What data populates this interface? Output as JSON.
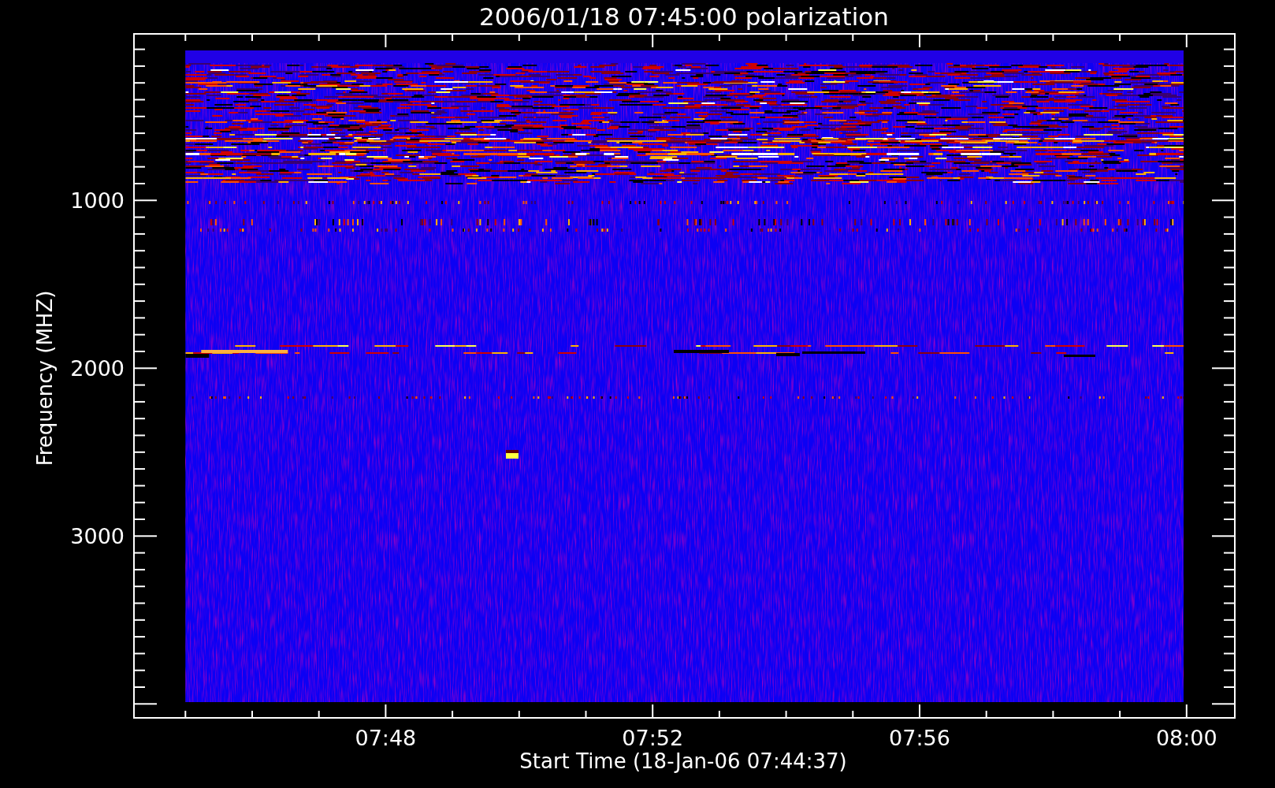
{
  "title": "2006/01/18 07:45:00 polarization",
  "xlabel": "Start Time (18-Jan-06 07:44:37)",
  "ylabel": "Frequency (MHZ)",
  "xticks": [
    "07:48",
    "07:52",
    "07:56",
    "08:00"
  ],
  "yticks": [
    "1000",
    "2000",
    "3000"
  ]
}
